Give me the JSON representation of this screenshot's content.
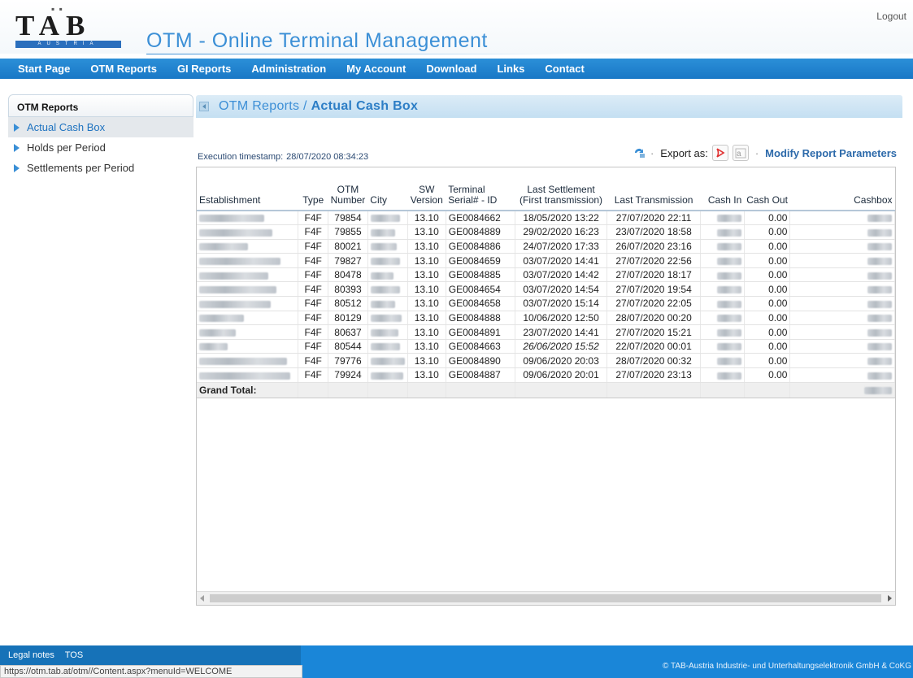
{
  "header": {
    "logo_letters": "TAB",
    "logo_sub": "AUSTRIA",
    "app_title": "OTM - Online Terminal Management",
    "logout": "Logout"
  },
  "nav": [
    "Start Page",
    "OTM Reports",
    "GI Reports",
    "Administration",
    "My Account",
    "Download",
    "Links",
    "Contact"
  ],
  "sidebar": {
    "heading": "OTM Reports",
    "items": [
      {
        "label": "Actual Cash Box",
        "active": true
      },
      {
        "label": "Holds per Period",
        "active": false
      },
      {
        "label": "Settlements per Period",
        "active": false
      }
    ]
  },
  "breadcrumb": {
    "parent": "OTM Reports /",
    "current": "Actual Cash Box"
  },
  "execution": {
    "label": "Execution timestamp:",
    "value": "28/07/2020 08:34:23"
  },
  "toolbar": {
    "export_label": "Export as:",
    "modify": "Modify Report Parameters"
  },
  "table": {
    "headers": [
      "Establishment",
      "Type",
      "OTM Number",
      "City",
      "SW Version",
      "Terminal Serial# - ID",
      "Last Settlement (First transmission)",
      "Last Transmission",
      "Cash In",
      "Cash Out",
      "Cashbox"
    ],
    "rows": [
      {
        "type": "F4F",
        "otm": "79854",
        "sw": "13.10",
        "serial": "GE0084662",
        "settle": "18/05/2020 13:22",
        "last": "27/07/2020 22:11",
        "cashout": "0.00"
      },
      {
        "type": "F4F",
        "otm": "79855",
        "sw": "13.10",
        "serial": "GE0084889",
        "settle": "29/02/2020 16:23",
        "last": "23/07/2020 18:58",
        "cashout": "0.00"
      },
      {
        "type": "F4F",
        "otm": "80021",
        "sw": "13.10",
        "serial": "GE0084886",
        "settle": "24/07/2020 17:33",
        "last": "26/07/2020 23:16",
        "cashout": "0.00"
      },
      {
        "type": "F4F",
        "otm": "79827",
        "sw": "13.10",
        "serial": "GE0084659",
        "settle": "03/07/2020 14:41",
        "last": "27/07/2020 22:56",
        "cashout": "0.00"
      },
      {
        "type": "F4F",
        "otm": "80478",
        "sw": "13.10",
        "serial": "GE0084885",
        "settle": "03/07/2020 14:42",
        "last": "27/07/2020 18:17",
        "cashout": "0.00"
      },
      {
        "type": "F4F",
        "otm": "80393",
        "sw": "13.10",
        "serial": "GE0084654",
        "settle": "03/07/2020 14:54",
        "last": "27/07/2020 19:54",
        "cashout": "0.00"
      },
      {
        "type": "F4F",
        "otm": "80512",
        "sw": "13.10",
        "serial": "GE0084658",
        "settle": "03/07/2020 15:14",
        "last": "27/07/2020 22:05",
        "cashout": "0.00"
      },
      {
        "type": "F4F",
        "otm": "80129",
        "sw": "13.10",
        "serial": "GE0084888",
        "settle": "10/06/2020 12:50",
        "last": "28/07/2020 00:20",
        "cashout": "0.00"
      },
      {
        "type": "F4F",
        "otm": "80637",
        "sw": "13.10",
        "serial": "GE0084891",
        "settle": "23/07/2020 14:41",
        "last": "27/07/2020 15:21",
        "cashout": "0.00"
      },
      {
        "type": "F4F",
        "otm": "80544",
        "sw": "13.10",
        "serial": "GE0084663",
        "settle": "26/06/2020 15:52",
        "last": "22/07/2020 00:01",
        "cashout": "0.00",
        "italic": true
      },
      {
        "type": "F4F",
        "otm": "79776",
        "sw": "13.10",
        "serial": "GE0084890",
        "settle": "09/06/2020 20:03",
        "last": "28/07/2020 00:32",
        "cashout": "0.00"
      },
      {
        "type": "F4F",
        "otm": "79924",
        "sw": "13.10",
        "serial": "GE0084887",
        "settle": "09/06/2020 20:01",
        "last": "27/07/2020 23:13",
        "cashout": "0.00"
      }
    ],
    "grand_total": "Grand Total:"
  },
  "footer": {
    "links": [
      "Legal notes",
      "TOS"
    ],
    "copyright": "© TAB-Austria Industrie- und Unterhaltungselektronik GmbH & CoKG"
  },
  "status_url": "https://otm.tab.at/otm//Content.aspx?menuId=WELCOME"
}
